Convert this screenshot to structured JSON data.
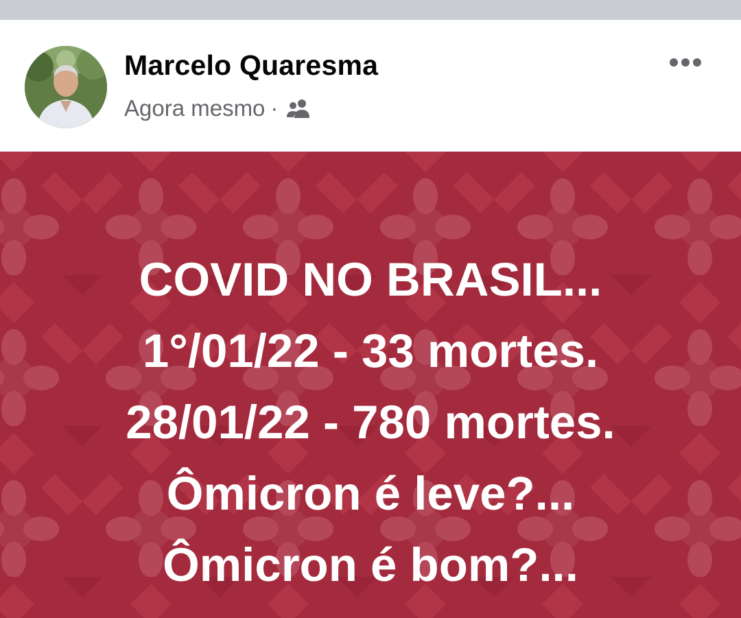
{
  "post": {
    "author": "Marcelo Quaresma",
    "timestamp": "Agora mesmo",
    "separator": "·",
    "audience_icon": "friends-icon",
    "more_icon": "more-options-icon",
    "background_color": "#a42b3e",
    "text_lines": [
      "COVID NO BRASIL...",
      "1°/01/22 - 33 mortes.",
      "28/01/22 - 780 mortes.",
      "Ômicron é leve?...",
      "Ômicron é bom?..."
    ]
  }
}
